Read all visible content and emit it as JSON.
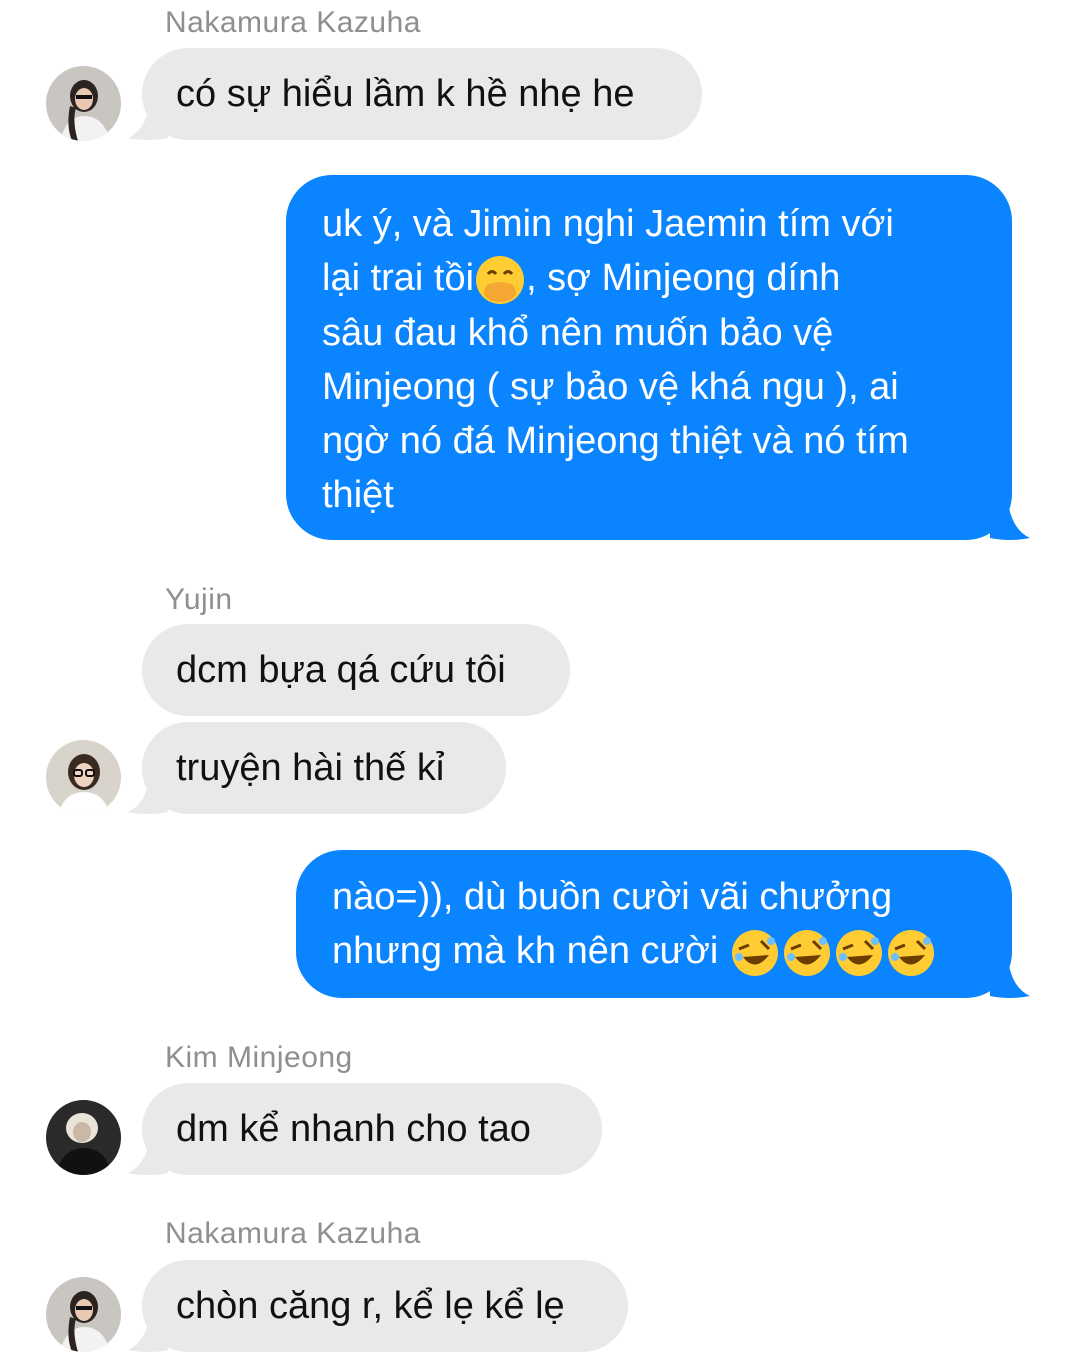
{
  "messages": [
    {
      "sender": "Nakamura Kazuha",
      "text": "có sự hiểu lầm k hề nhẹ he"
    },
    {
      "text_line1": "uk ý, và Jimin nghi Jaemin tím với",
      "text_line2a": "lại trai tồi",
      "emoji1": "facepalm-grin",
      "text_line2b": ", sợ Minjeong dính",
      "text_line3": "sâu đau khổ nên muốn bảo vệ",
      "text_line4": "Minjeong ( sự bảo vệ khá ngu ), ai",
      "text_line5": "ngờ nó đá Minjeong thiệt và nó tím",
      "text_line6": "thiệt"
    },
    {
      "sender": "Yujin",
      "text": "dcm bựa qá cứu tôi"
    },
    {
      "text": "truyện hài thế kỉ"
    },
    {
      "line1": "nào=)), dù buồn cười vãi chưởng",
      "line2": "nhưng mà kh nên cười "
    },
    {
      "sender": "Kim Minjeong",
      "text": "dm kể nhanh cho tao"
    },
    {
      "sender": "Nakamura Kazuha",
      "text": "chòn căng r, kể lẹ kể lẹ"
    }
  ],
  "colors": {
    "incoming": "#e9e9eb",
    "outgoing": "#0a84ff"
  }
}
